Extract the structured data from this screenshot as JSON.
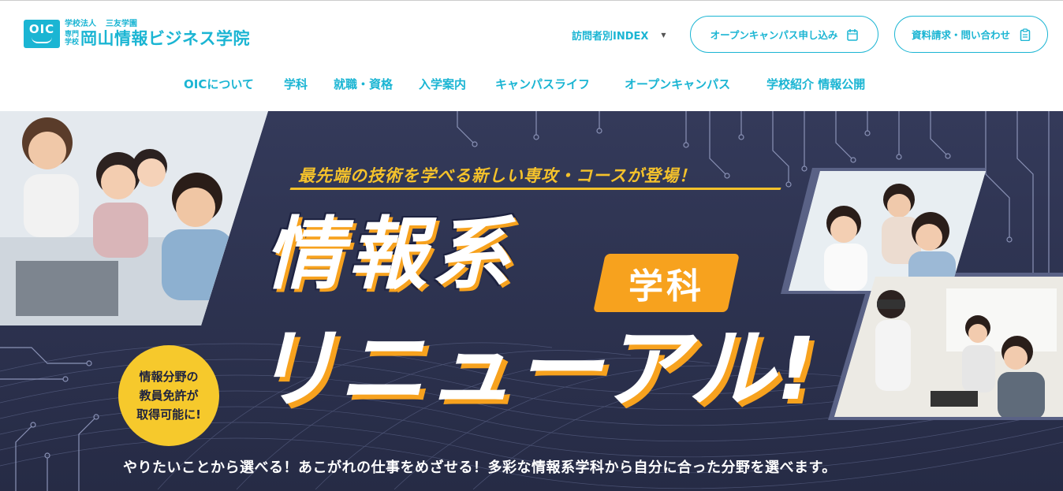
{
  "header": {
    "logo": {
      "mark": "OIC",
      "corp": "学校法人",
      "group": "三友学園",
      "small": "専門学校",
      "name": "岡山情報ビジネス学院"
    },
    "visitor_index": "訪問者別INDEX",
    "open_campus_button": "オープンキャンパス申し込み",
    "request_button": "資料請求・問い合わせ"
  },
  "nav": {
    "items": [
      "OICについて",
      "学科",
      "就職・資格",
      "入学案内",
      "キャンパスライフ",
      "オープンキャンパス",
      "学校紹介 情報公開"
    ]
  },
  "hero": {
    "tagline": "最先端の技術を学べる新しい専攻・コースが登場！",
    "title_main": "情報系",
    "title_badge": "学科",
    "title_sub": "リニューアル!",
    "circle_badge": [
      "情報分野の",
      "教員免許が",
      "取得可能に!"
    ],
    "bottom_copy": "やりたいことから選べる！あこがれの仕事をめざせる！多彩な情報系学科から自分に合った分野を選べます。"
  },
  "colors": {
    "accent": "#1bb5d3",
    "hero_bg": "#2d3350",
    "highlight_orange": "#f7a21e",
    "highlight_yellow": "#f5c22b"
  }
}
